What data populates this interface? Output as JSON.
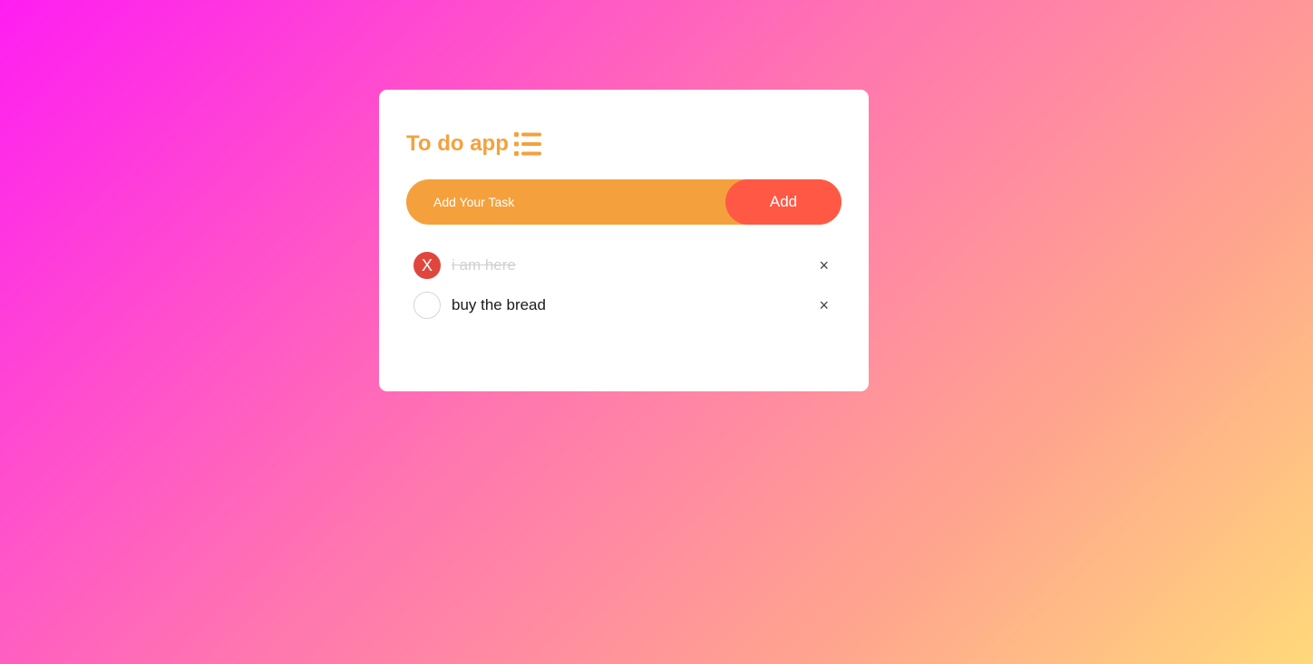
{
  "app": {
    "title": "To do app",
    "title_icon": "list-icon",
    "accent_color": "#f4a13d",
    "button_color": "#ff5945"
  },
  "input": {
    "placeholder": "Add Your Task",
    "value": ""
  },
  "add_button": {
    "label": "Add"
  },
  "tasks": [
    {
      "text": "i am here",
      "done": true,
      "check_mark": "X",
      "delete_label": "×"
    },
    {
      "text": "buy the bread",
      "done": false,
      "check_mark": "",
      "delete_label": "×"
    }
  ]
}
